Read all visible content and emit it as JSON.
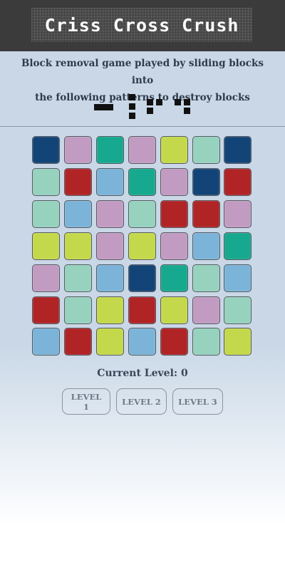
{
  "header": {
    "title": "Criss Cross Crush"
  },
  "description": {
    "line1": "Block removal game played by sliding blocks into",
    "line2": "the following patterns to destroy blocks"
  },
  "palette": {
    "N": "#124477",
    "P": "#c29bc2",
    "T": "#17a98f",
    "Y": "#c4d84b",
    "M": "#96d2bd",
    "R": "#b02426",
    "B": "#7bb4d8"
  },
  "board": {
    "rows": [
      [
        "N",
        "P",
        "T",
        "P",
        "Y",
        "M",
        "N"
      ],
      [
        "M",
        "R",
        "B",
        "T",
        "P",
        "N",
        "R"
      ],
      [
        "M",
        "B",
        "P",
        "M",
        "R",
        "R",
        "P"
      ],
      [
        "Y",
        "Y",
        "P",
        "Y",
        "P",
        "B",
        "T"
      ],
      [
        "P",
        "M",
        "B",
        "N",
        "T",
        "M",
        "B"
      ],
      [
        "R",
        "M",
        "Y",
        "R",
        "Y",
        "P",
        "M"
      ],
      [
        "B",
        "R",
        "Y",
        "B",
        "R",
        "M",
        "Y"
      ]
    ]
  },
  "status": {
    "current_level": "Current Level: 0"
  },
  "levels": [
    {
      "label": "LEVEL 1"
    },
    {
      "label": "LEVEL 2"
    },
    {
      "label": "LEVEL 3"
    }
  ]
}
